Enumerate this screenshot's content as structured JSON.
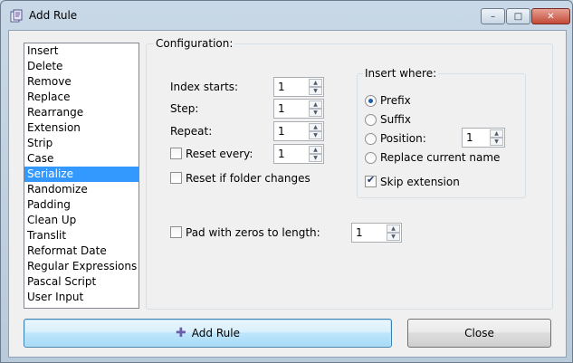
{
  "window": {
    "title": "Add Rule",
    "controls": {
      "minimize": "–",
      "maximize": "□",
      "close": "✕"
    }
  },
  "rules": [
    {
      "label": "Insert"
    },
    {
      "label": "Delete"
    },
    {
      "label": "Remove"
    },
    {
      "label": "Replace"
    },
    {
      "label": "Rearrange"
    },
    {
      "label": "Extension"
    },
    {
      "label": "Strip"
    },
    {
      "label": "Case"
    },
    {
      "label": "Serialize",
      "selected": true
    },
    {
      "label": "Randomize"
    },
    {
      "label": "Padding"
    },
    {
      "label": "Clean Up"
    },
    {
      "label": "Translit"
    },
    {
      "label": "Reformat Date"
    },
    {
      "label": "Regular Expressions"
    },
    {
      "label": "Pascal Script"
    },
    {
      "label": "User Input"
    }
  ],
  "config": {
    "title": "Configuration:",
    "index_starts": {
      "label": "Index starts:",
      "value": "1"
    },
    "step": {
      "label": "Step:",
      "value": "1"
    },
    "repeat": {
      "label": "Repeat:",
      "value": "1"
    },
    "reset_every": {
      "label": "Reset every:",
      "value": "1",
      "checked": false
    },
    "reset_folder": {
      "label": "Reset if folder changes",
      "checked": false
    },
    "pad_zeros": {
      "label": "Pad with zeros to length:",
      "value": "1",
      "checked": false
    },
    "insert_where": {
      "title": "Insert where:",
      "prefix": {
        "label": "Prefix",
        "selected": true
      },
      "suffix": {
        "label": "Suffix",
        "selected": false
      },
      "position": {
        "label": "Position:",
        "value": "1",
        "selected": false
      },
      "replace_name": {
        "label": "Replace current name",
        "selected": false
      },
      "skip_extension": {
        "label": "Skip extension",
        "checked": true
      }
    }
  },
  "buttons": {
    "add_rule": "Add Rule",
    "close": "Close"
  },
  "spin_arrows": {
    "up": "▲",
    "down": "▼"
  },
  "icons": {
    "add": "plus-icon",
    "app": "rename-app-icon"
  }
}
